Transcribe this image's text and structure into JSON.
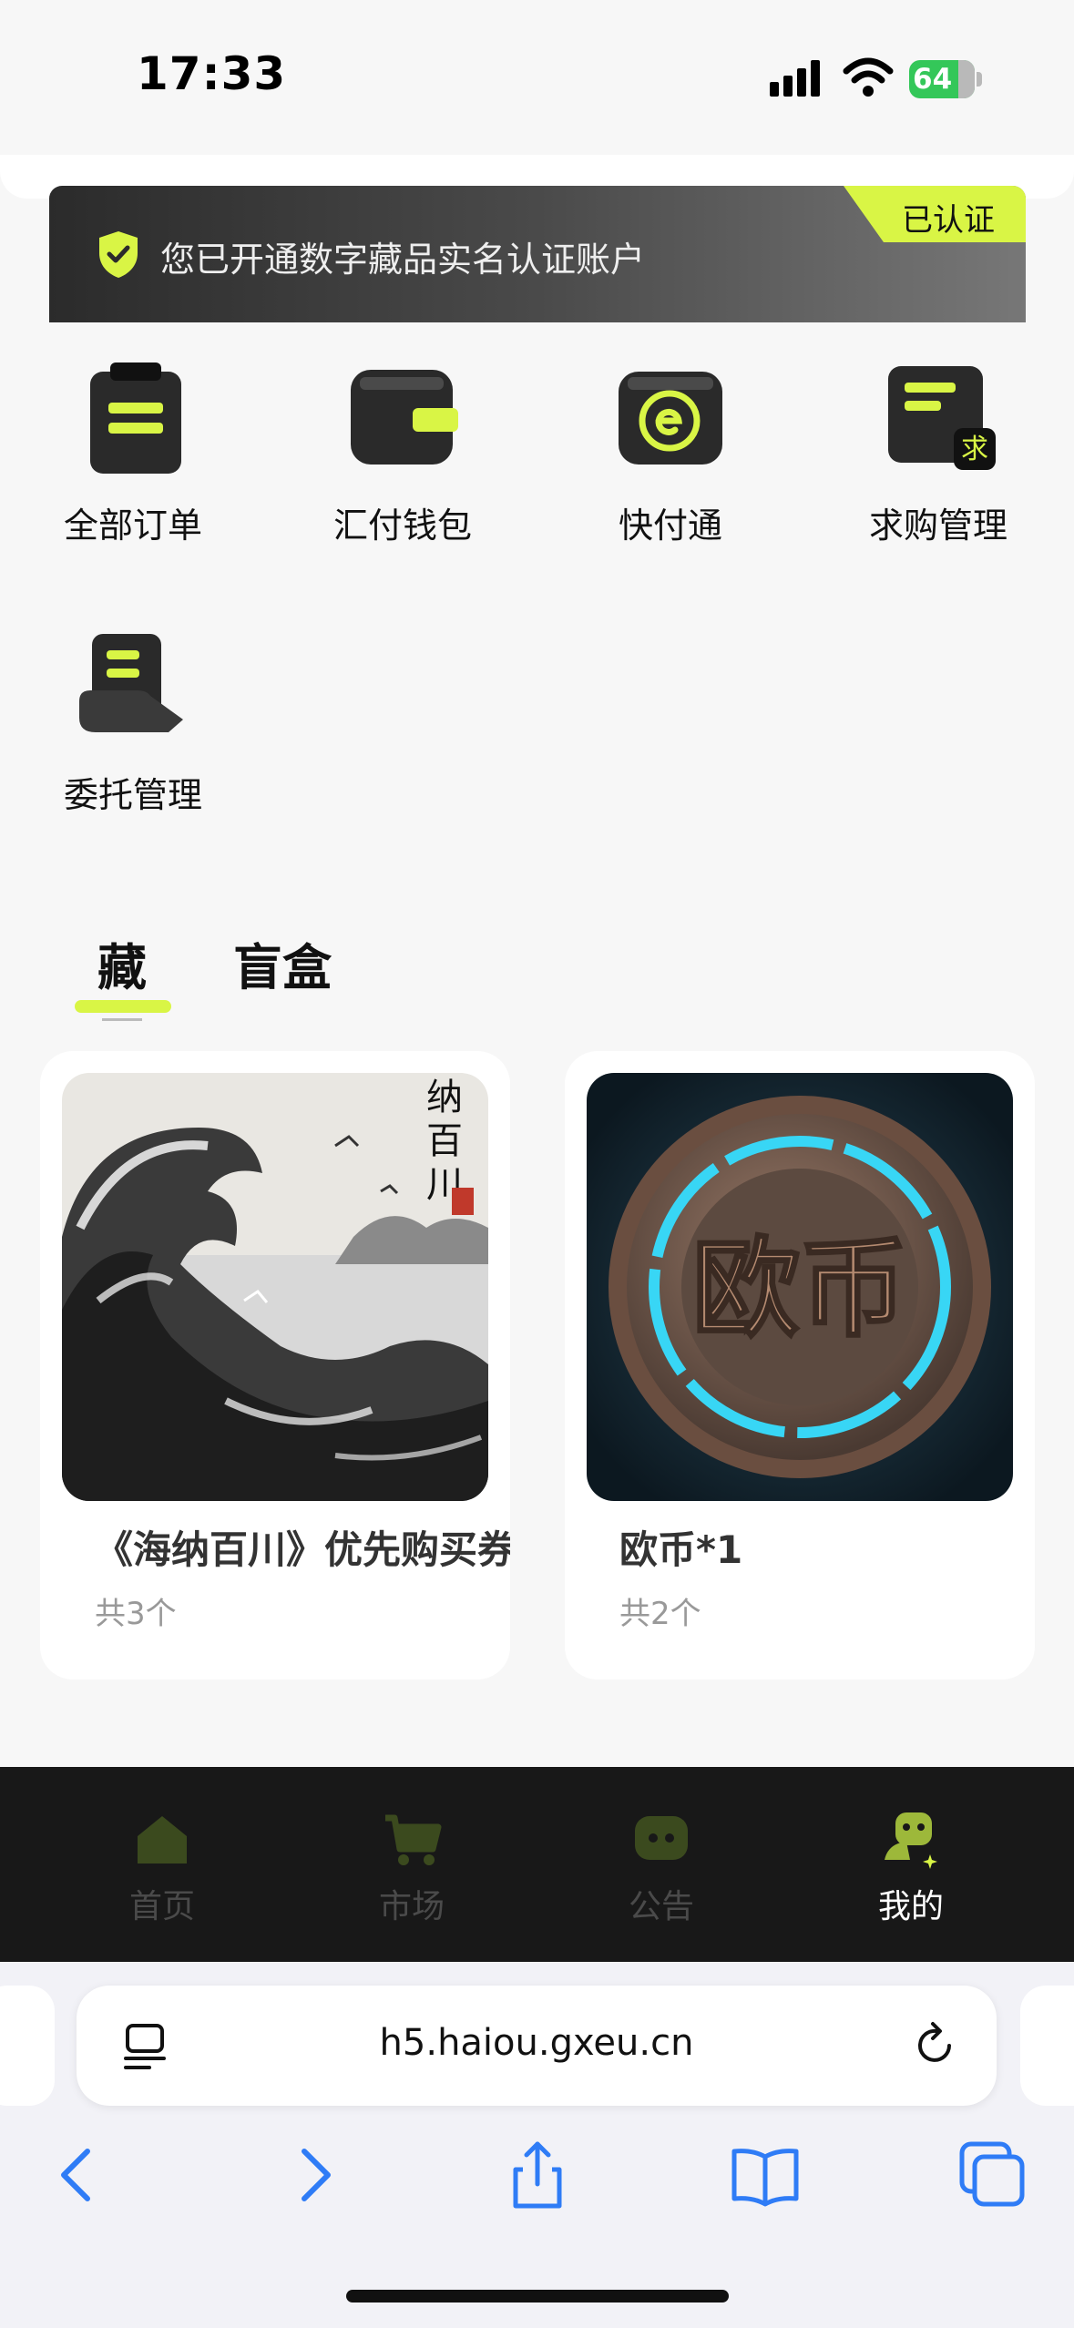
{
  "status_bar": {
    "time": "17:33",
    "battery": "64"
  },
  "verify_banner": {
    "text": "您已开通数字藏品实名认证账户",
    "badge": "已认证"
  },
  "menu": [
    {
      "label": "全部订单",
      "icon": "orders-icon"
    },
    {
      "label": "汇付钱包",
      "icon": "wallet-icon"
    },
    {
      "label": "快付通",
      "icon": "quick-pay-icon"
    },
    {
      "label": "求购管理",
      "icon": "purchase-request-icon"
    },
    {
      "label": "委托管理",
      "icon": "consignment-icon"
    }
  ],
  "tabs": [
    {
      "label": "藏",
      "active": true
    },
    {
      "label": "盲盒",
      "active": false
    }
  ],
  "cards": [
    {
      "title": "《海纳百川》优先购买券",
      "count": "共3个",
      "image_text": "纳百川"
    },
    {
      "title": "欧币*1",
      "count": "共2个",
      "image_text": "欧币"
    }
  ],
  "bottom_nav": [
    {
      "label": "首页",
      "icon": "home-icon"
    },
    {
      "label": "市场",
      "icon": "cart-icon"
    },
    {
      "label": "公告",
      "icon": "announcement-icon"
    },
    {
      "label": "我的",
      "icon": "profile-mascot-icon",
      "active": true
    }
  ],
  "browser": {
    "url": "h5.haiou.gxeu.cn"
  },
  "colors": {
    "accent": "#d9f545",
    "dark": "#181818",
    "ios_blue": "#2f7cf6"
  }
}
